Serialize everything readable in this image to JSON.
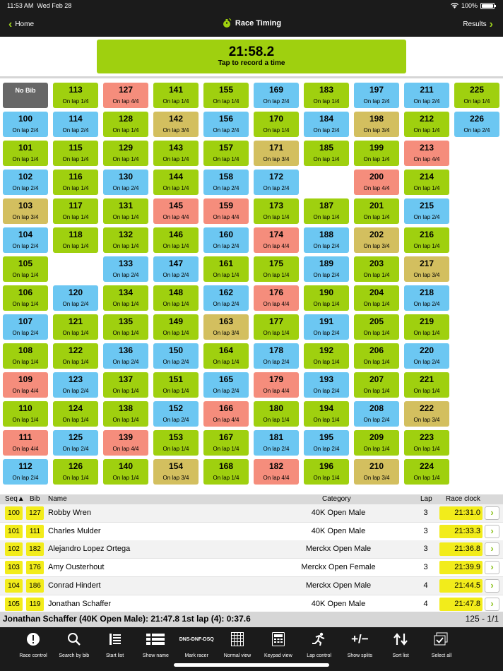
{
  "status": {
    "time": "11:53 AM",
    "date": "Wed Feb 28",
    "battery": "100%"
  },
  "nav": {
    "back_label": "Home",
    "title": "Race Timing",
    "forward_label": "Results"
  },
  "timer": {
    "time": "21:58.2",
    "subtitle": "Tap to record a time"
  },
  "colors": {
    "green": "#9fd00f",
    "blue": "#6cc7f2",
    "red": "#f58d7c",
    "tan": "#d3bf5f",
    "gray": "#676767",
    "highlight": "#f2ec1b"
  },
  "no_bib_label": "No Bib",
  "bib_grid": [
    [
      {
        "bib": "113",
        "lap": "On lap 1/4",
        "s": "green"
      },
      {
        "bib": "127",
        "lap": "On lap 4/4",
        "s": "red"
      },
      {
        "bib": "141",
        "lap": "On lap 1/4",
        "s": "green"
      },
      {
        "bib": "155",
        "lap": "On lap 1/4",
        "s": "green"
      },
      {
        "bib": "169",
        "lap": "On lap 2/4",
        "s": "blue"
      },
      {
        "bib": "183",
        "lap": "On lap 1/4",
        "s": "green"
      },
      {
        "bib": "197",
        "lap": "On lap 2/4",
        "s": "blue"
      },
      {
        "bib": "211",
        "lap": "On lap 2/4",
        "s": "blue"
      },
      {
        "bib": "225",
        "lap": "On lap 1/4",
        "s": "green"
      }
    ],
    [
      {
        "bib": "100",
        "lap": "On lap 2/4",
        "s": "blue"
      },
      {
        "bib": "114",
        "lap": "On lap 2/4",
        "s": "blue"
      },
      {
        "bib": "128",
        "lap": "On lap 1/4",
        "s": "green"
      },
      {
        "bib": "142",
        "lap": "On lap 3/4",
        "s": "tan"
      },
      {
        "bib": "156",
        "lap": "On lap 2/4",
        "s": "blue"
      },
      {
        "bib": "170",
        "lap": "On lap 1/4",
        "s": "green"
      },
      {
        "bib": "184",
        "lap": "On lap 2/4",
        "s": "blue"
      },
      {
        "bib": "198",
        "lap": "On lap 3/4",
        "s": "tan"
      },
      {
        "bib": "212",
        "lap": "On lap 1/4",
        "s": "green"
      },
      {
        "bib": "226",
        "lap": "On lap 2/4",
        "s": "blue"
      }
    ],
    [
      {
        "bib": "101",
        "lap": "On lap 1/4",
        "s": "green"
      },
      {
        "bib": "115",
        "lap": "On lap 1/4",
        "s": "green"
      },
      {
        "bib": "129",
        "lap": "On lap 1/4",
        "s": "green"
      },
      {
        "bib": "143",
        "lap": "On lap 1/4",
        "s": "green"
      },
      {
        "bib": "157",
        "lap": "On lap 1/4",
        "s": "green"
      },
      {
        "bib": "171",
        "lap": "On lap 3/4",
        "s": "tan"
      },
      {
        "bib": "185",
        "lap": "On lap 1/4",
        "s": "green"
      },
      {
        "bib": "199",
        "lap": "On lap 1/4",
        "s": "green"
      },
      {
        "bib": "213",
        "lap": "On lap 4/4",
        "s": "red"
      },
      null
    ],
    [
      {
        "bib": "102",
        "lap": "On lap 2/4",
        "s": "blue"
      },
      {
        "bib": "116",
        "lap": "On lap 1/4",
        "s": "green"
      },
      {
        "bib": "130",
        "lap": "On lap 2/4",
        "s": "blue"
      },
      {
        "bib": "144",
        "lap": "On lap 1/4",
        "s": "green"
      },
      {
        "bib": "158",
        "lap": "On lap 2/4",
        "s": "blue"
      },
      {
        "bib": "172",
        "lap": "On lap 2/4",
        "s": "blue"
      },
      null,
      {
        "bib": "200",
        "lap": "On lap 4/4",
        "s": "red"
      },
      {
        "bib": "214",
        "lap": "On lap 1/4",
        "s": "green"
      },
      null
    ],
    [
      {
        "bib": "103",
        "lap": "On lap 3/4",
        "s": "tan"
      },
      {
        "bib": "117",
        "lap": "On lap 1/4",
        "s": "green"
      },
      {
        "bib": "131",
        "lap": "On lap 1/4",
        "s": "green"
      },
      {
        "bib": "145",
        "lap": "On lap 4/4",
        "s": "red"
      },
      {
        "bib": "159",
        "lap": "On lap 4/4",
        "s": "red"
      },
      {
        "bib": "173",
        "lap": "On lap 1/4",
        "s": "green"
      },
      {
        "bib": "187",
        "lap": "On lap 1/4",
        "s": "green"
      },
      {
        "bib": "201",
        "lap": "On lap 1/4",
        "s": "green"
      },
      {
        "bib": "215",
        "lap": "On lap 2/4",
        "s": "blue"
      },
      null
    ],
    [
      {
        "bib": "104",
        "lap": "On lap 2/4",
        "s": "blue"
      },
      {
        "bib": "118",
        "lap": "On lap 1/4",
        "s": "green"
      },
      {
        "bib": "132",
        "lap": "On lap 1/4",
        "s": "green"
      },
      {
        "bib": "146",
        "lap": "On lap 1/4",
        "s": "green"
      },
      {
        "bib": "160",
        "lap": "On lap 2/4",
        "s": "blue"
      },
      {
        "bib": "174",
        "lap": "On lap 4/4",
        "s": "red"
      },
      {
        "bib": "188",
        "lap": "On lap 2/4",
        "s": "blue"
      },
      {
        "bib": "202",
        "lap": "On lap 3/4",
        "s": "tan"
      },
      {
        "bib": "216",
        "lap": "On lap 1/4",
        "s": "green"
      },
      null
    ],
    [
      {
        "bib": "105",
        "lap": "On lap 1/4",
        "s": "green"
      },
      null,
      {
        "bib": "133",
        "lap": "On lap 2/4",
        "s": "blue"
      },
      {
        "bib": "147",
        "lap": "On lap 2/4",
        "s": "blue"
      },
      {
        "bib": "161",
        "lap": "On lap 1/4",
        "s": "green"
      },
      {
        "bib": "175",
        "lap": "On lap 1/4",
        "s": "green"
      },
      {
        "bib": "189",
        "lap": "On lap 2/4",
        "s": "blue"
      },
      {
        "bib": "203",
        "lap": "On lap 1/4",
        "s": "green"
      },
      {
        "bib": "217",
        "lap": "On lap 3/4",
        "s": "tan"
      },
      null
    ],
    [
      {
        "bib": "106",
        "lap": "On lap 1/4",
        "s": "green"
      },
      {
        "bib": "120",
        "lap": "On lap 2/4",
        "s": "blue"
      },
      {
        "bib": "134",
        "lap": "On lap 1/4",
        "s": "green"
      },
      {
        "bib": "148",
        "lap": "On lap 1/4",
        "s": "green"
      },
      {
        "bib": "162",
        "lap": "On lap 2/4",
        "s": "blue"
      },
      {
        "bib": "176",
        "lap": "On lap 4/4",
        "s": "red"
      },
      {
        "bib": "190",
        "lap": "On lap 1/4",
        "s": "green"
      },
      {
        "bib": "204",
        "lap": "On lap 1/4",
        "s": "green"
      },
      {
        "bib": "218",
        "lap": "On lap 2/4",
        "s": "blue"
      },
      null
    ],
    [
      {
        "bib": "107",
        "lap": "On lap 2/4",
        "s": "blue"
      },
      {
        "bib": "121",
        "lap": "On lap 1/4",
        "s": "green"
      },
      {
        "bib": "135",
        "lap": "On lap 1/4",
        "s": "green"
      },
      {
        "bib": "149",
        "lap": "On lap 1/4",
        "s": "green"
      },
      {
        "bib": "163",
        "lap": "On lap 3/4",
        "s": "tan"
      },
      {
        "bib": "177",
        "lap": "On lap 1/4",
        "s": "green"
      },
      {
        "bib": "191",
        "lap": "On lap 2/4",
        "s": "blue"
      },
      {
        "bib": "205",
        "lap": "On lap 1/4",
        "s": "green"
      },
      {
        "bib": "219",
        "lap": "On lap 1/4",
        "s": "green"
      },
      null
    ],
    [
      {
        "bib": "108",
        "lap": "On lap 1/4",
        "s": "green"
      },
      {
        "bib": "122",
        "lap": "On lap 1/4",
        "s": "green"
      },
      {
        "bib": "136",
        "lap": "On lap 2/4",
        "s": "blue"
      },
      {
        "bib": "150",
        "lap": "On lap 2/4",
        "s": "blue"
      },
      {
        "bib": "164",
        "lap": "On lap 1/4",
        "s": "green"
      },
      {
        "bib": "178",
        "lap": "On lap 2/4",
        "s": "blue"
      },
      {
        "bib": "192",
        "lap": "On lap 1/4",
        "s": "green"
      },
      {
        "bib": "206",
        "lap": "On lap 1/4",
        "s": "green"
      },
      {
        "bib": "220",
        "lap": "On lap 2/4",
        "s": "blue"
      },
      null
    ],
    [
      {
        "bib": "109",
        "lap": "On lap 4/4",
        "s": "red"
      },
      {
        "bib": "123",
        "lap": "On lap 2/4",
        "s": "blue"
      },
      {
        "bib": "137",
        "lap": "On lap 1/4",
        "s": "green"
      },
      {
        "bib": "151",
        "lap": "On lap 1/4",
        "s": "green"
      },
      {
        "bib": "165",
        "lap": "On lap 2/4",
        "s": "blue"
      },
      {
        "bib": "179",
        "lap": "On lap 4/4",
        "s": "red"
      },
      {
        "bib": "193",
        "lap": "On lap 2/4",
        "s": "blue"
      },
      {
        "bib": "207",
        "lap": "On lap 1/4",
        "s": "green"
      },
      {
        "bib": "221",
        "lap": "On lap 1/4",
        "s": "green"
      },
      null
    ],
    [
      {
        "bib": "110",
        "lap": "On lap 1/4",
        "s": "green"
      },
      {
        "bib": "124",
        "lap": "On lap 1/4",
        "s": "green"
      },
      {
        "bib": "138",
        "lap": "On lap 1/4",
        "s": "green"
      },
      {
        "bib": "152",
        "lap": "On lap 2/4",
        "s": "blue"
      },
      {
        "bib": "166",
        "lap": "On lap 4/4",
        "s": "red"
      },
      {
        "bib": "180",
        "lap": "On lap 1/4",
        "s": "green"
      },
      {
        "bib": "194",
        "lap": "On lap 1/4",
        "s": "green"
      },
      {
        "bib": "208",
        "lap": "On lap 2/4",
        "s": "blue"
      },
      {
        "bib": "222",
        "lap": "On lap 3/4",
        "s": "tan"
      },
      null
    ],
    [
      {
        "bib": "111",
        "lap": "On lap 4/4",
        "s": "red"
      },
      {
        "bib": "125",
        "lap": "On lap 2/4",
        "s": "blue"
      },
      {
        "bib": "139",
        "lap": "On lap 4/4",
        "s": "red"
      },
      {
        "bib": "153",
        "lap": "On lap 1/4",
        "s": "green"
      },
      {
        "bib": "167",
        "lap": "On lap 1/4",
        "s": "green"
      },
      {
        "bib": "181",
        "lap": "On lap 2/4",
        "s": "blue"
      },
      {
        "bib": "195",
        "lap": "On lap 2/4",
        "s": "blue"
      },
      {
        "bib": "209",
        "lap": "On lap 1/4",
        "s": "green"
      },
      {
        "bib": "223",
        "lap": "On lap 1/4",
        "s": "green"
      },
      null
    ],
    [
      {
        "bib": "112",
        "lap": "On lap 2/4",
        "s": "blue"
      },
      {
        "bib": "126",
        "lap": "On lap 1/4",
        "s": "green"
      },
      {
        "bib": "140",
        "lap": "On lap 1/4",
        "s": "green"
      },
      {
        "bib": "154",
        "lap": "On lap 3/4",
        "s": "tan"
      },
      {
        "bib": "168",
        "lap": "On lap 1/4",
        "s": "green"
      },
      {
        "bib": "182",
        "lap": "On lap 4/4",
        "s": "red"
      },
      {
        "bib": "196",
        "lap": "On lap 1/4",
        "s": "green"
      },
      {
        "bib": "210",
        "lap": "On lap 3/4",
        "s": "tan"
      },
      {
        "bib": "224",
        "lap": "On lap 1/4",
        "s": "green"
      },
      null
    ]
  ],
  "list": {
    "headers": {
      "seq": "Seq▲",
      "bib": "Bib",
      "name": "Name",
      "category": "Category",
      "lap": "Lap",
      "clock": "Race clock"
    },
    "rows": [
      {
        "seq": "100",
        "bib": "127",
        "name": "Robby Wren",
        "category": "40K Open Male",
        "lap": "3",
        "clock": "21:31.0"
      },
      {
        "seq": "101",
        "bib": "111",
        "name": "Charles Mulder",
        "category": "40K Open Male",
        "lap": "3",
        "clock": "21:33.3"
      },
      {
        "seq": "102",
        "bib": "182",
        "name": "Alejandro Lopez Ortega",
        "category": "Merckx Open Male",
        "lap": "3",
        "clock": "21:36.8"
      },
      {
        "seq": "103",
        "bib": "176",
        "name": "Amy Ousterhout",
        "category": "Merckx Open Female",
        "lap": "3",
        "clock": "21:39.9"
      },
      {
        "seq": "104",
        "bib": "186",
        "name": "Conrad Hindert",
        "category": "Merckx Open Male",
        "lap": "4",
        "clock": "21:44.5"
      },
      {
        "seq": "105",
        "bib": "119",
        "name": "Jonathan Schaffer",
        "category": "40K Open Male",
        "lap": "4",
        "clock": "21:47.8"
      }
    ]
  },
  "summary": {
    "text": "Jonathan Schaffer (40K Open Male): 21:47.8 1st lap (4): 0:37.6",
    "count": "125 - 1/1"
  },
  "toolbar": [
    {
      "label": "Race control",
      "icon": "alert-icon"
    },
    {
      "label": "Search by bib",
      "icon": "search-icon"
    },
    {
      "label": "Start list",
      "icon": "start-list-icon"
    },
    {
      "label": "Show name",
      "icon": "list-icon"
    },
    {
      "label": "Mark racer",
      "icon": "dns-dnf-dsq-icon",
      "icon_text": "DNS-DNF-DSQ"
    },
    {
      "label": "Normal view",
      "icon": "grid-icon"
    },
    {
      "label": "Keypad view",
      "icon": "keypad-icon"
    },
    {
      "label": "Lap control",
      "icon": "runner-icon"
    },
    {
      "label": "Show splits",
      "icon": "plus-minus-icon",
      "icon_text": "+/−"
    },
    {
      "label": "Sort list",
      "icon": "sort-icon"
    },
    {
      "label": "Select all",
      "icon": "select-all-icon"
    }
  ]
}
